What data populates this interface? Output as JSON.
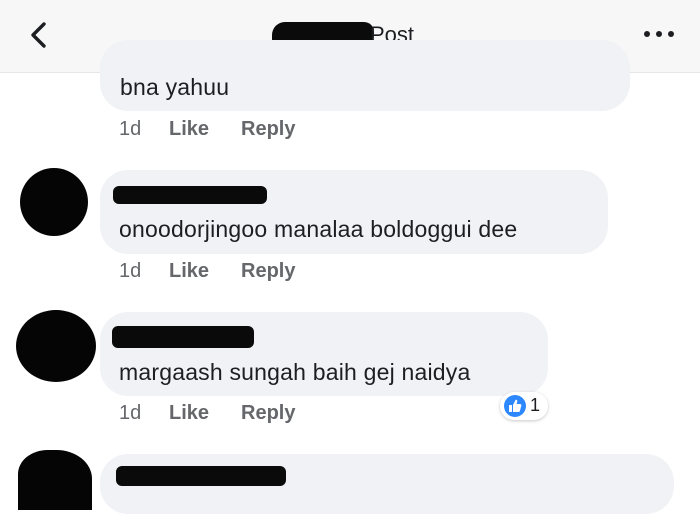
{
  "header": {
    "title": "Post",
    "back_icon": "chevron-left-icon",
    "more_icon": "more-dots-icon"
  },
  "comments": [
    {
      "text": "bna yahuu",
      "time": "1d",
      "like_label": "Like",
      "reply_label": "Reply"
    },
    {
      "text": "onoodorjingoo manalaa boldoggui dee",
      "time": "1d",
      "like_label": "Like",
      "reply_label": "Reply"
    },
    {
      "text": "margaash sungah baih gej naidya",
      "time": "1d",
      "like_label": "Like",
      "reply_label": "Reply",
      "reaction": {
        "icon": "thumbs-up-icon",
        "count": "1",
        "color": "#2d88ff"
      }
    }
  ]
}
